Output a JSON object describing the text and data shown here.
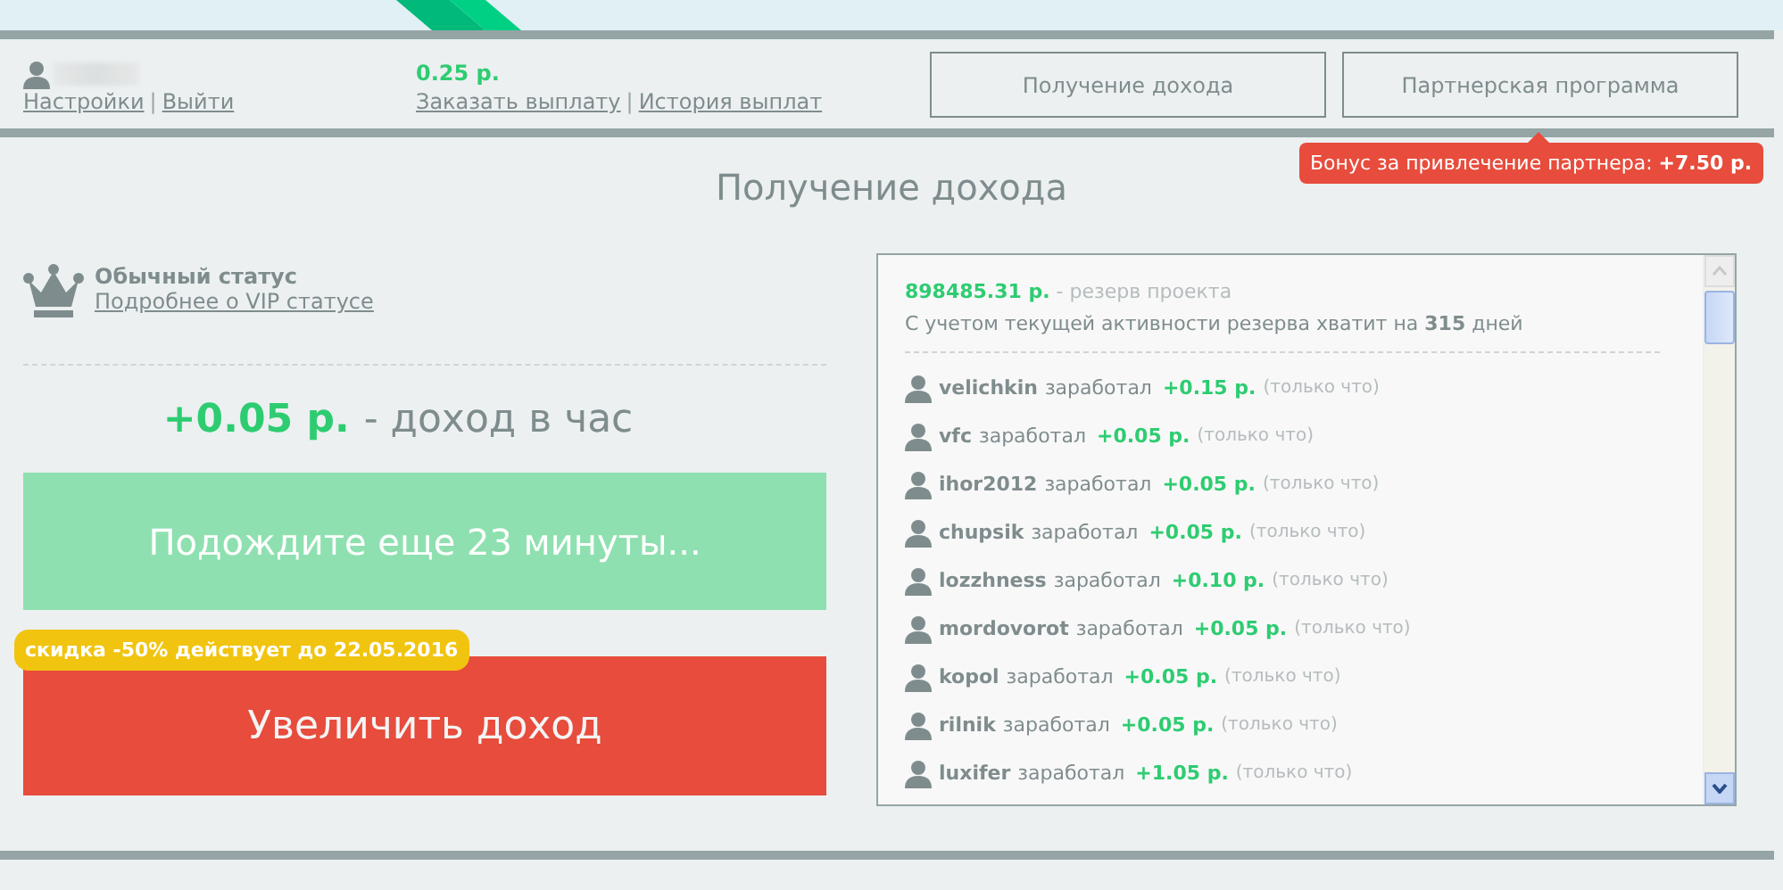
{
  "header": {
    "links_left": [
      "Настройки",
      "Выйти"
    ],
    "separator": "|",
    "balance": "0.25 р.",
    "links_mid": [
      "Заказать выплату",
      "История выплат"
    ],
    "nav": [
      "Получение дохода",
      "Партнерская программа"
    ],
    "tooltip": "Бонус за привлечение партнера: **+7.50 р.**"
  },
  "title": "Получение дохода",
  "status": {
    "name": "Обычный статус",
    "link": "Подробнее о VIP статусе"
  },
  "income": {
    "amount": "+0.05 р.",
    "label": "- доход в час"
  },
  "wait_button": "Подождите еще 23 минуты...",
  "discount_badge": "скидка -50% действует до 22.05.2016",
  "boost_button": "Увеличить доход",
  "feed": {
    "reserve": "898485.31 р.",
    "reserve_label": "- резерв проекта",
    "forecast": "С учетом текущей активности резерва хватит на **315** дней",
    "rows": [
      {
        "user": "velichkin",
        "verb": "заработал",
        "amount": "+0.15 р.",
        "time": "(только что)"
      },
      {
        "user": "vfc",
        "verb": "заработал",
        "amount": "+0.05 р.",
        "time": "(только что)"
      },
      {
        "user": "ihor2012",
        "verb": "заработал",
        "amount": "+0.05 р.",
        "time": "(только что)"
      },
      {
        "user": "chupsik",
        "verb": "заработал",
        "amount": "+0.05 р.",
        "time": "(только что)"
      },
      {
        "user": "lozzhness",
        "verb": "заработал",
        "amount": "+0.10 р.",
        "time": "(только что)"
      },
      {
        "user": "mordovorot",
        "verb": "заработал",
        "amount": "+0.05 р.",
        "time": "(только что)"
      },
      {
        "user": "kopol",
        "verb": "заработал",
        "amount": "+0.05 р.",
        "time": "(только что)"
      },
      {
        "user": "rilnik",
        "verb": "заработал",
        "amount": "+0.05 р.",
        "time": "(только что)"
      },
      {
        "user": "luxifer",
        "verb": "заработал",
        "amount": "+1.05 р.",
        "time": "(только что)"
      }
    ]
  }
}
